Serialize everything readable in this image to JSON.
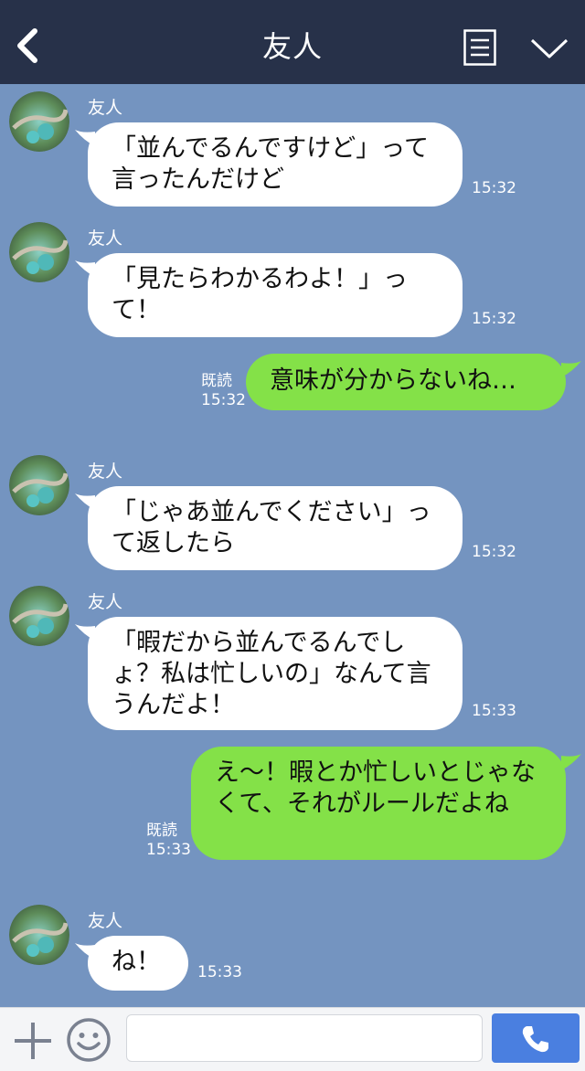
{
  "header": {
    "title": "友人",
    "back_icon": "chevron-left-icon",
    "menu_icon": "menu-icon",
    "collapse_icon": "chevron-down-icon"
  },
  "colors": {
    "header_bg": "#273149",
    "chat_bg": "#7494c0",
    "incoming_bubble": "#ffffff",
    "outgoing_bubble": "#84e148",
    "call_button": "#4a7fe0"
  },
  "messages": [
    {
      "sender": "友人",
      "text": "「並んでるんですけど」って言ったんだけど",
      "time": "15:32"
    },
    {
      "sender": "友人",
      "text": "「見たらわかるわよ！」って！",
      "time": "15:32"
    },
    {
      "outgoing": true,
      "read": "既読",
      "text": "意味が分からないね…",
      "time": "15:32"
    },
    {
      "sender": "友人",
      "text": "「じゃあ並んでください」って返したら",
      "time": "15:32"
    },
    {
      "sender": "友人",
      "text": "「暇だから並んでるんでしょ？私は忙しいの」なんて言うんだよ！",
      "time": "15:33"
    },
    {
      "outgoing": true,
      "read": "既読",
      "text": "え〜！暇とか忙しいとじゃなくて、それがルールだよね",
      "time": "15:33"
    },
    {
      "sender": "友人",
      "text": "ね！",
      "time": "15:33"
    }
  ],
  "footer": {
    "plus_icon": "plus-icon",
    "emoji_icon": "smile-icon",
    "call_icon": "phone-icon",
    "input_value": ""
  }
}
